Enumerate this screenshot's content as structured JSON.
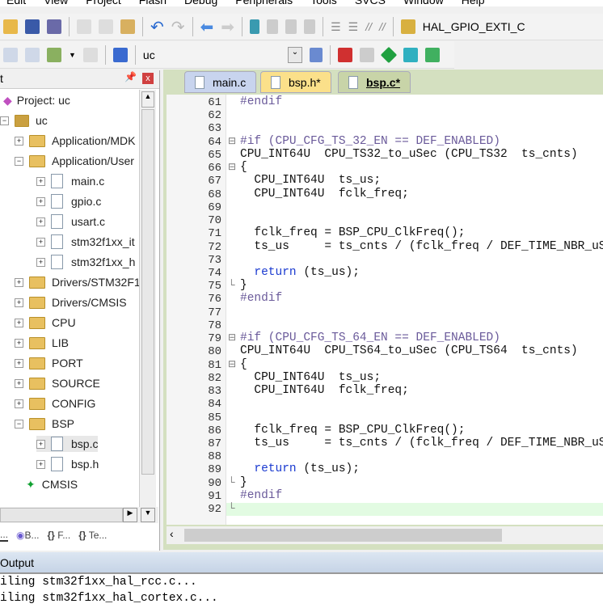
{
  "menu": [
    "Edit",
    "View",
    "Project",
    "Flash",
    "Debug",
    "Peripherals",
    "Tools",
    "SVCS",
    "Window",
    "Help"
  ],
  "toolbar": {
    "find_combo": "HAL_GPIO_EXTI_C",
    "target_select": "uc"
  },
  "project_panel": {
    "title": "t",
    "tree": [
      {
        "label": "Project: uc",
        "level": 0,
        "type": "root"
      },
      {
        "label": "uc",
        "level": 1,
        "type": "target",
        "expanded": true
      },
      {
        "label": "Application/MDK",
        "level": 2,
        "type": "folder",
        "expanded": false
      },
      {
        "label": "Application/User",
        "level": 2,
        "type": "folder",
        "expanded": true
      },
      {
        "label": "main.c",
        "level": 3,
        "type": "file"
      },
      {
        "label": "gpio.c",
        "level": 3,
        "type": "file"
      },
      {
        "label": "usart.c",
        "level": 3,
        "type": "file"
      },
      {
        "label": "stm32f1xx_it",
        "level": 3,
        "type": "file"
      },
      {
        "label": "stm32f1xx_h",
        "level": 3,
        "type": "file"
      },
      {
        "label": "Drivers/STM32F1",
        "level": 2,
        "type": "folder",
        "expanded": false
      },
      {
        "label": "Drivers/CMSIS",
        "level": 2,
        "type": "folder",
        "expanded": false
      },
      {
        "label": "CPU",
        "level": 2,
        "type": "folder",
        "expanded": false
      },
      {
        "label": "LIB",
        "level": 2,
        "type": "folder",
        "expanded": false
      },
      {
        "label": "PORT",
        "level": 2,
        "type": "folder",
        "expanded": false
      },
      {
        "label": "SOURCE",
        "level": 2,
        "type": "folder",
        "expanded": false
      },
      {
        "label": "CONFIG",
        "level": 2,
        "type": "folder",
        "expanded": false
      },
      {
        "label": "BSP",
        "level": 2,
        "type": "folder",
        "expanded": true
      },
      {
        "label": "bsp.c",
        "level": 3,
        "type": "file",
        "selected": true
      },
      {
        "label": "bsp.h",
        "level": 3,
        "type": "file"
      },
      {
        "label": "CMSIS",
        "level": 2,
        "type": "component"
      }
    ],
    "bottom_tabs": [
      "...",
      "B...",
      "F...",
      "Te..."
    ]
  },
  "editor": {
    "tabs": [
      {
        "label": "main.c",
        "color": "#c8d4ee"
      },
      {
        "label": "bsp.h*",
        "color": "#fbe08a"
      },
      {
        "label": "bsp.c*",
        "color": "#c8d4a8",
        "active": true
      }
    ],
    "lines": [
      {
        "n": "61",
        "t": "#endif",
        "k": "pp"
      },
      {
        "n": "62",
        "t": ""
      },
      {
        "n": "63",
        "t": ""
      },
      {
        "n": "64",
        "t": "#if (CPU_CFG_TS_32_EN == DEF_ENABLED)",
        "k": "pp",
        "f": "⊟"
      },
      {
        "n": "65",
        "t": "CPU_INT64U  CPU_TS32_to_uSec (CPU_TS32  ts_cnts)"
      },
      {
        "n": "66",
        "t": "{",
        "f": "⊟"
      },
      {
        "n": "67",
        "t": "  CPU_INT64U  ts_us;"
      },
      {
        "n": "68",
        "t": "  CPU_INT64U  fclk_freq;"
      },
      {
        "n": "69",
        "t": ""
      },
      {
        "n": "70",
        "t": ""
      },
      {
        "n": "71",
        "t": "  fclk_freq = BSP_CPU_ClkFreq();"
      },
      {
        "n": "72",
        "t": "  ts_us     = ts_cnts / (fclk_freq / DEF_TIME_NBR_uS_"
      },
      {
        "n": "73",
        "t": ""
      },
      {
        "n": "74",
        "t": "  return (ts_us);",
        "k": "ret"
      },
      {
        "n": "75",
        "t": "}",
        "f": "└"
      },
      {
        "n": "76",
        "t": "#endif",
        "k": "pp"
      },
      {
        "n": "77",
        "t": ""
      },
      {
        "n": "78",
        "t": ""
      },
      {
        "n": "79",
        "t": "#if (CPU_CFG_TS_64_EN == DEF_ENABLED)",
        "k": "pp",
        "f": "⊟"
      },
      {
        "n": "80",
        "t": "CPU_INT64U  CPU_TS64_to_uSec (CPU_TS64  ts_cnts)"
      },
      {
        "n": "81",
        "t": "{",
        "f": "⊟"
      },
      {
        "n": "82",
        "t": "  CPU_INT64U  ts_us;"
      },
      {
        "n": "83",
        "t": "  CPU_INT64U  fclk_freq;"
      },
      {
        "n": "84",
        "t": ""
      },
      {
        "n": "85",
        "t": ""
      },
      {
        "n": "86",
        "t": "  fclk_freq = BSP_CPU_ClkFreq();"
      },
      {
        "n": "87",
        "t": "  ts_us     = ts_cnts / (fclk_freq / DEF_TIME_NBR_uS_"
      },
      {
        "n": "88",
        "t": ""
      },
      {
        "n": "89",
        "t": "  return (ts_us);",
        "k": "ret"
      },
      {
        "n": "90",
        "t": "}",
        "f": "└"
      },
      {
        "n": "91",
        "t": "#endif",
        "k": "pp"
      },
      {
        "n": "92",
        "t": "",
        "current": true,
        "f": "└"
      }
    ]
  },
  "output": {
    "title": "Output",
    "lines": [
      "iling stm32f1xx_hal_rcc.c...",
      "iling stm32f1xx_hal_cortex.c..."
    ]
  }
}
